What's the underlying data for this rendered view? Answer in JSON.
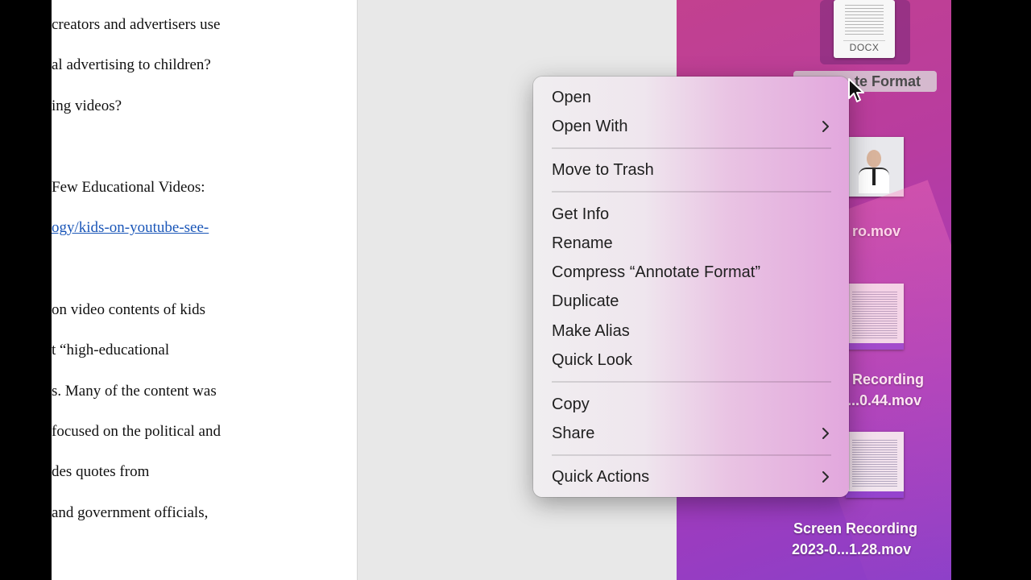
{
  "document": {
    "lines": [
      "creators and advertisers use",
      "al advertising to children?",
      "ing videos?",
      "Few Educational Videos:",
      "ogy/kids-on-youtube-see-",
      "on video contents of kids",
      "t “high-educational",
      "s. Many of the content was",
      "focused on the political and",
      "des quotes from",
      " and government officials,"
    ]
  },
  "desktop": {
    "selected_file": {
      "badge": "DOCX",
      "label": "te Format"
    },
    "files": [
      {
        "label_lines": [
          "ro.mov"
        ]
      },
      {
        "label_lines": [
          "Recording",
          "...0.44.mov"
        ]
      },
      {
        "label_lines": [
          "Screen Recording",
          "2023-0...1.28.mov"
        ]
      }
    ]
  },
  "context_menu": {
    "items": [
      {
        "label": "Open"
      },
      {
        "label": "Open With",
        "submenu": true
      },
      {
        "label": "Move to Trash"
      },
      {
        "label": "Get Info"
      },
      {
        "label": "Rename"
      },
      {
        "label": "Compress “Annotate Format”"
      },
      {
        "label": "Duplicate"
      },
      {
        "label": "Make Alias"
      },
      {
        "label": "Quick Look"
      },
      {
        "label": "Copy"
      },
      {
        "label": "Share",
        "submenu": true
      },
      {
        "label": "Quick Actions",
        "submenu": true
      }
    ]
  },
  "colors": {
    "desktop_accent": "#b83ca0",
    "link": "#1a56b8",
    "menu_text": "#1f1f1f"
  },
  "icons": [
    "chevron-right-icon",
    "pointer-cursor-icon",
    "docx-file-icon"
  ]
}
